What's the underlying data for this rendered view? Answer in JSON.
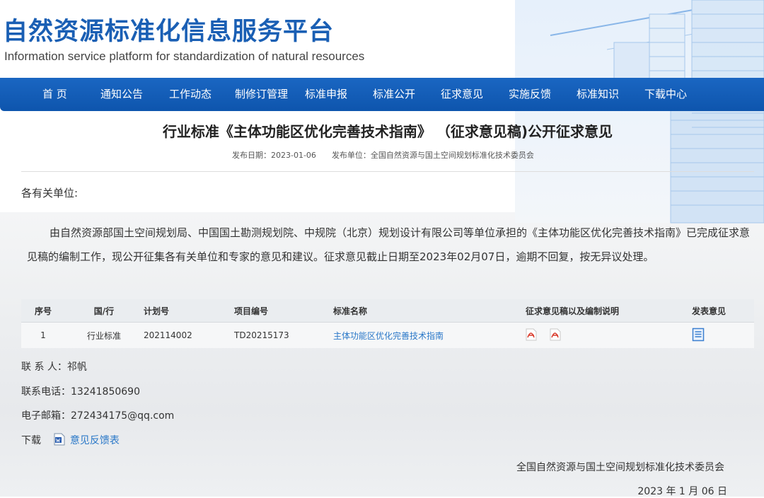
{
  "header": {
    "title": "自然资源标准化信息服务平台",
    "subtitle": "Information service platform for standardization of natural resources"
  },
  "nav": [
    "首 页",
    "通知公告",
    "工作动态",
    "制修订管理",
    "标准申报",
    "标准公开",
    "征求意见",
    "实施反馈",
    "标准知识",
    "下载中心"
  ],
  "article": {
    "title": "行业标准《主体功能区优化完善技术指南》 （征求意见稿)公开征求意见",
    "publish_date": "发布日期：2023-01-06",
    "publisher": "发布单位：全国自然资源与国土空间规划标准化技术委员会",
    "salutation": "各有关单位:",
    "body": "由自然资源部国土空间规划局、中国国土勘测规划院、中规院（北京）规划设计有限公司等单位承担的《主体功能区优化完善技术指南》已完成征求意见稿的编制工作，现公开征集各有关单位和专家的意见和建议。征求意见截止日期至2023年02月07日，逾期不回复，按无异议处理。"
  },
  "table": {
    "headers": [
      "序号",
      "国/行",
      "计划号",
      "项目编号",
      "标准名称",
      "征求意见稿以及编制说明",
      "发表意见"
    ],
    "rows": [
      {
        "index": "1",
        "level": "行业标准",
        "plan": "202114002",
        "project": "TD20215173",
        "name": "主体功能区优化完善技术指南"
      }
    ]
  },
  "contact": {
    "person": "联 系 人：祁帆",
    "phone": "联系电话：13241850690",
    "email": "电子邮箱：272434175@qq.com",
    "download_label": "下载",
    "download_link": "意见反馈表"
  },
  "footer": {
    "org": "全国自然资源与国土空间规划标准化技术委员会",
    "date": "2023 年 1 月 06 日"
  },
  "colors": {
    "nav_bg": "#1a66c2",
    "title_blue": "#1a5fb4",
    "link": "#2a78c8",
    "pdf_red": "#d93a2b"
  },
  "icons": {
    "pdf": "pdf-file-icon",
    "comment": "comment-form-icon",
    "word": "word-document-icon"
  }
}
